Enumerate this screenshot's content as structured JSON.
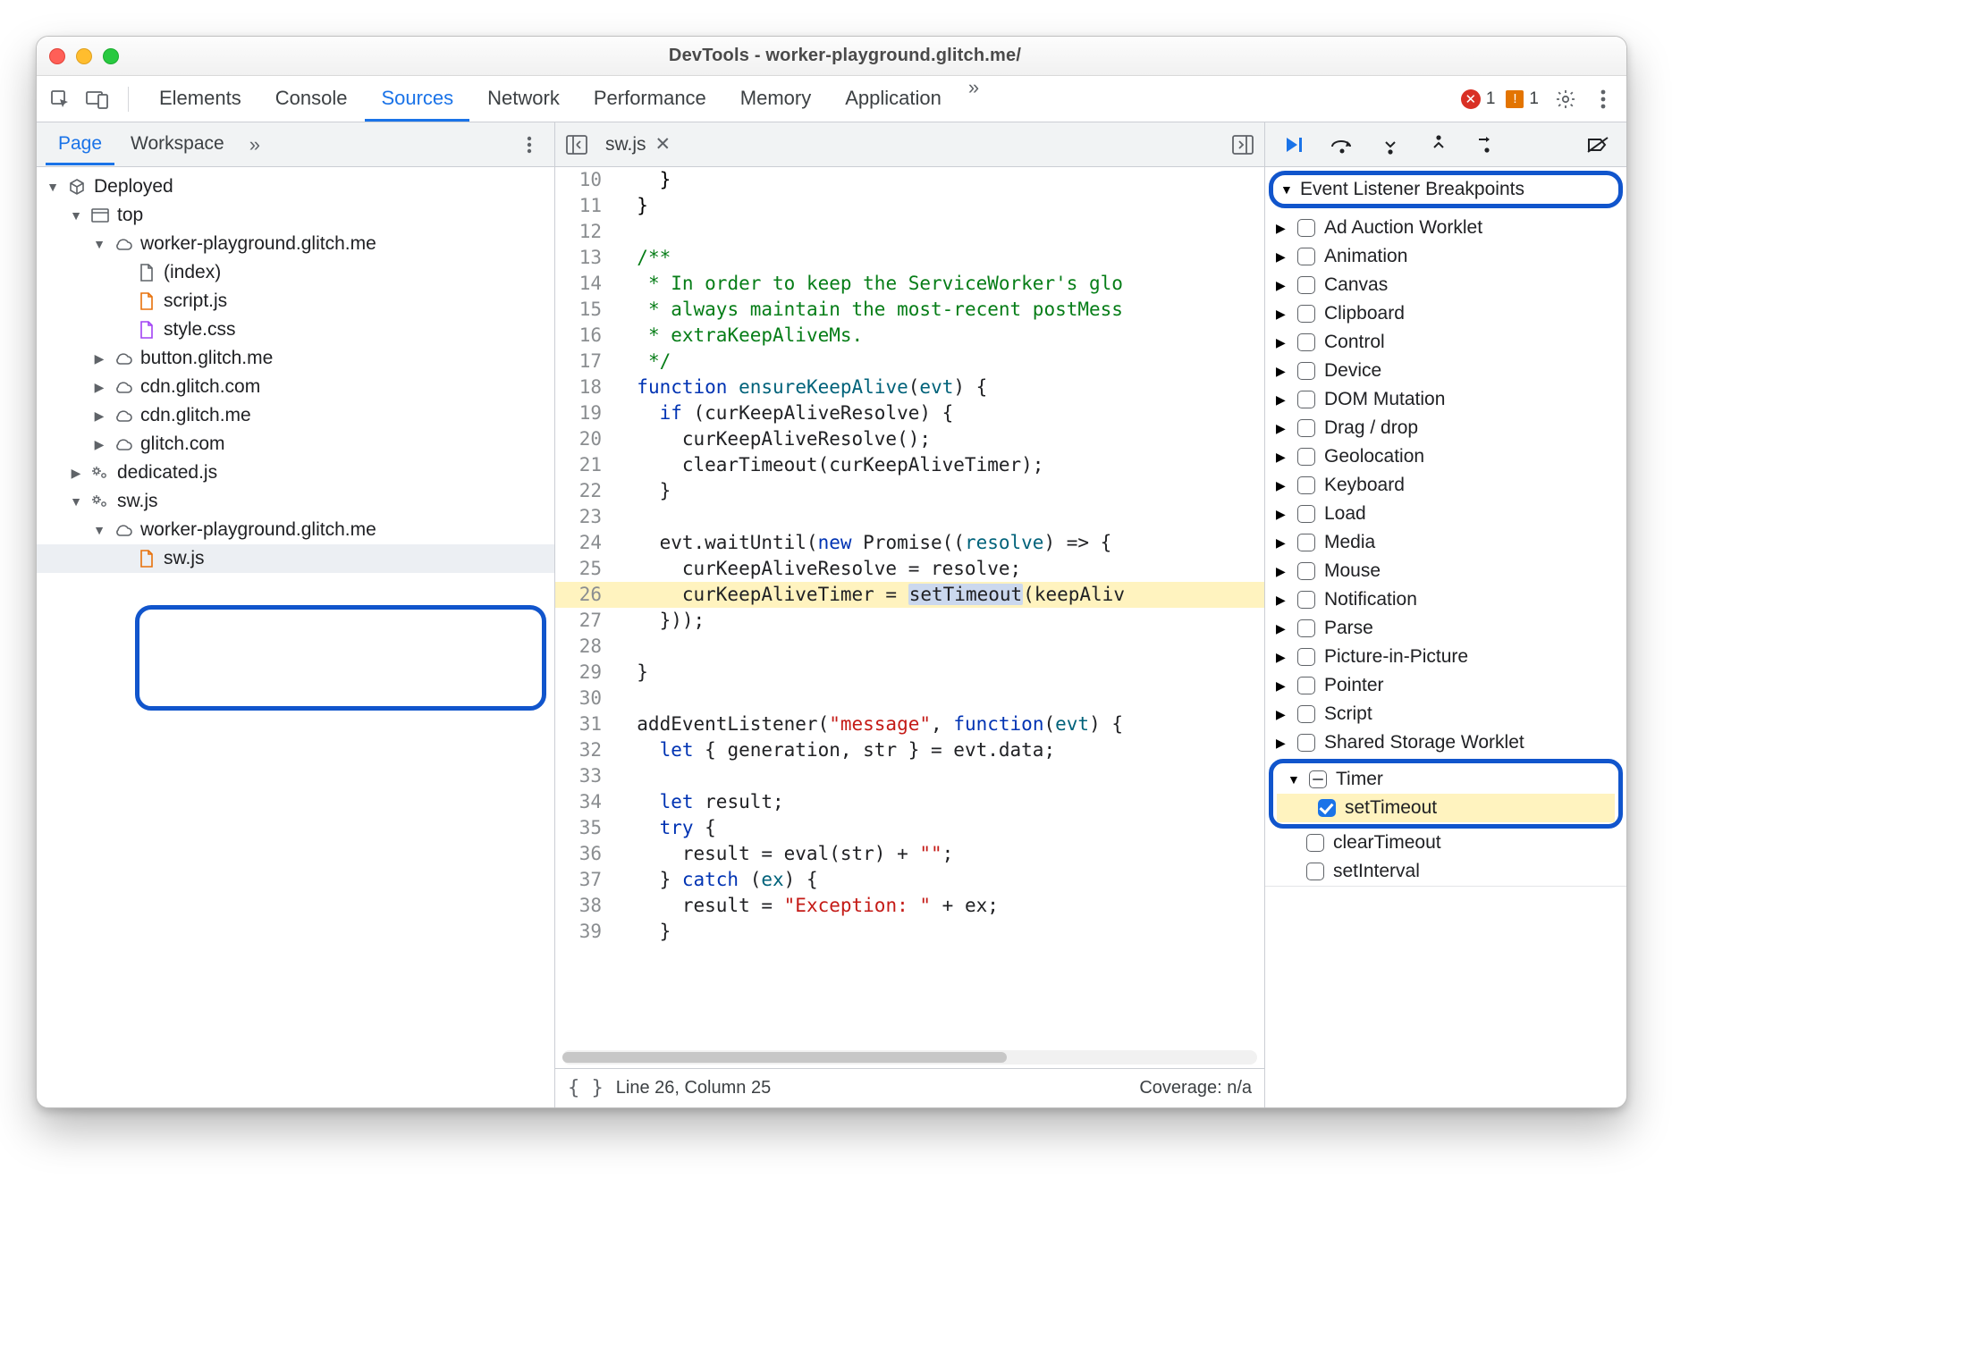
{
  "title": "DevTools - worker-playground.glitch.me/",
  "maintabs": {
    "elements": "Elements",
    "console": "Console",
    "sources": "Sources",
    "network": "Network",
    "performance": "Performance",
    "memory": "Memory",
    "application": "Application",
    "more": "»",
    "active": "sources"
  },
  "indicators": {
    "errors": "1",
    "warnings": "1"
  },
  "left": {
    "tabs": {
      "page": "Page",
      "workspace": "Workspace",
      "more": "»"
    },
    "tree": {
      "deployed": "Deployed",
      "top": "top",
      "workerPg": "worker-playground.glitch.me",
      "index": "(index)",
      "scriptjs": "script.js",
      "stylecss": "style.css",
      "button": "button.glitch.me",
      "cdn1": "cdn.glitch.com",
      "cdn2": "cdn.glitch.me",
      "glitch": "glitch.com",
      "dedicated": "dedicated.js",
      "swjs": "sw.js",
      "swWorker": "worker-playground.glitch.me",
      "swFile": "sw.js"
    }
  },
  "editor": {
    "tab": "sw.js",
    "lines": [
      {
        "n": 10,
        "html": "    <span class='c-black'>}</span>"
      },
      {
        "n": 11,
        "html": "  <span class='c-black'>}</span>"
      },
      {
        "n": 12,
        "html": ""
      },
      {
        "n": 13,
        "html": "  <span class='c-green'>/**</span>"
      },
      {
        "n": 14,
        "html": "  <span class='c-green'> * In order to keep the ServiceWorker's glo</span>"
      },
      {
        "n": 15,
        "html": "  <span class='c-green'> * always maintain the most-recent postMess</span>"
      },
      {
        "n": 16,
        "html": "  <span class='c-green'> * extraKeepAliveMs.</span>"
      },
      {
        "n": 17,
        "html": "  <span class='c-green'> */</span>"
      },
      {
        "n": 18,
        "html": "  <span class='c-blue'>function</span> <span class='c-navy'>ensureKeepAlive</span>(<span class='c-navy'>evt</span>) {"
      },
      {
        "n": 19,
        "html": "    <span class='c-blue'>if</span> (curKeepAliveResolve) {"
      },
      {
        "n": 20,
        "html": "      curKeepAliveResolve();"
      },
      {
        "n": 21,
        "html": "      clearTimeout(curKeepAliveTimer);"
      },
      {
        "n": 22,
        "html": "    }"
      },
      {
        "n": 23,
        "html": ""
      },
      {
        "n": 24,
        "html": "    evt.waitUntil(<span class='c-blue'>new</span> Promise((<span class='c-navy'>resolve</span>) => {"
      },
      {
        "n": 25,
        "html": "      curKeepAliveResolve = resolve;"
      },
      {
        "n": 26,
        "hl": true,
        "html": "      curKeepAliveTimer = <span class='hl-sel'>setTimeout</span>(keepAliv"
      },
      {
        "n": 27,
        "html": "    }));"
      },
      {
        "n": 28,
        "html": ""
      },
      {
        "n": 29,
        "html": "  }"
      },
      {
        "n": 30,
        "html": ""
      },
      {
        "n": 31,
        "html": "  addEventListener(<span class='c-red'>\"message\"</span>, <span class='c-blue'>function</span>(<span class='c-navy'>evt</span>) {"
      },
      {
        "n": 32,
        "html": "    <span class='c-blue'>let</span> { generation, str } = evt.data;"
      },
      {
        "n": 33,
        "html": ""
      },
      {
        "n": 34,
        "html": "    <span class='c-blue'>let</span> result;"
      },
      {
        "n": 35,
        "html": "    <span class='c-blue'>try</span> {"
      },
      {
        "n": 36,
        "html": "      result = eval(str) + <span class='c-red'>\"\"</span>;"
      },
      {
        "n": 37,
        "html": "    } <span class='c-blue'>catch</span> (<span class='c-navy'>ex</span>) {"
      },
      {
        "n": 38,
        "html": "      result = <span class='c-red'>\"Exception: \"</span> + ex;"
      },
      {
        "n": 39,
        "html": "    }"
      }
    ],
    "status": {
      "pos": "Line 26, Column 25",
      "coverage": "Coverage: n/a"
    }
  },
  "debugger": {
    "section": "Event Listener Breakpoints",
    "cats": [
      "Ad Auction Worklet",
      "Animation",
      "Canvas",
      "Clipboard",
      "Control",
      "Device",
      "DOM Mutation",
      "Drag / drop",
      "Geolocation",
      "Keyboard",
      "Load",
      "Media",
      "Mouse",
      "Notification",
      "Parse",
      "Picture-in-Picture",
      "Pointer",
      "Script",
      "Shared Storage Worklet"
    ],
    "timer": {
      "label": "Timer",
      "setTimeout": "setTimeout",
      "clearTimeout": "clearTimeout",
      "setInterval": "setInterval"
    }
  }
}
